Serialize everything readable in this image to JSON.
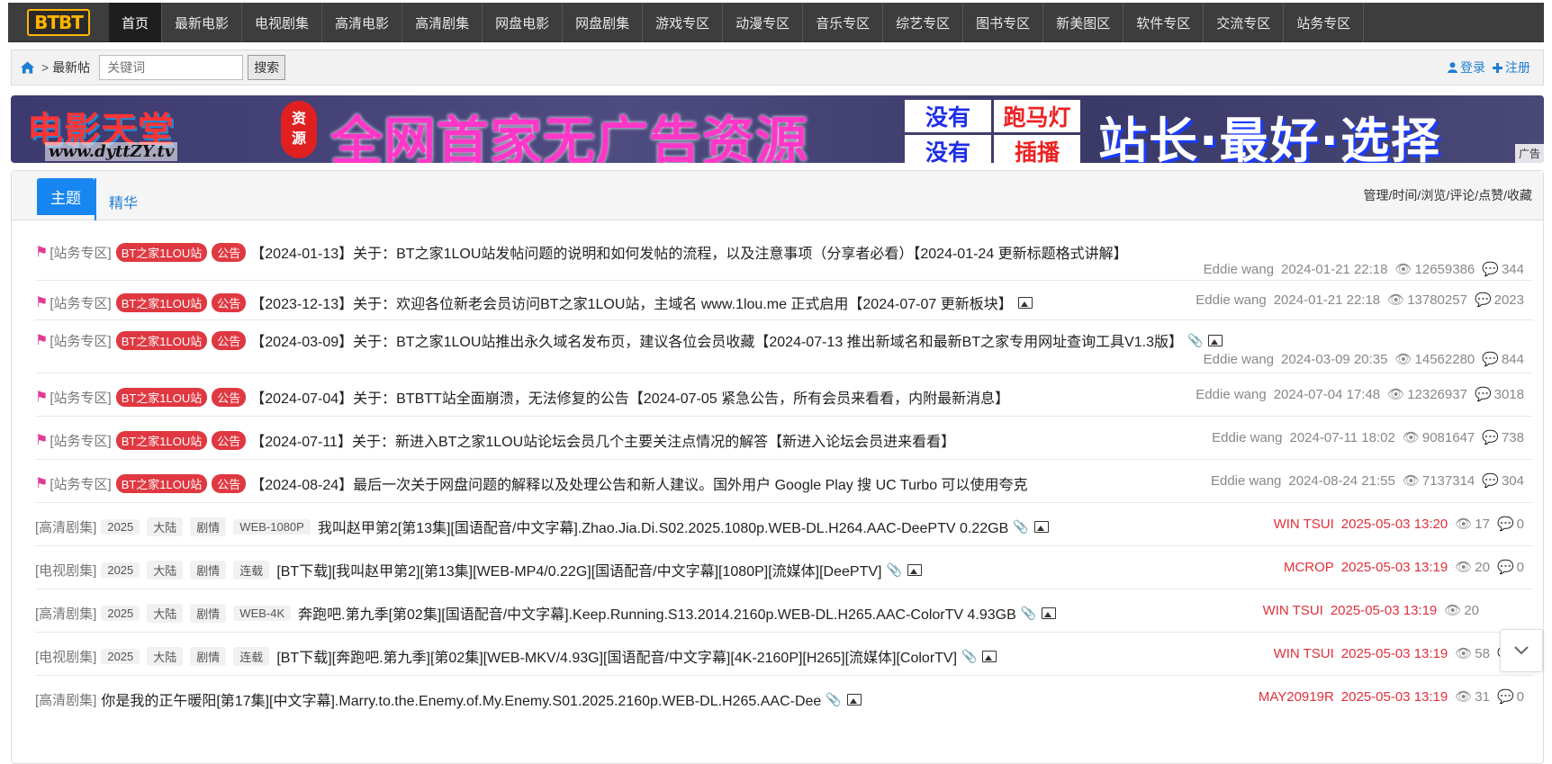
{
  "site": {
    "logo_text": "BTBT"
  },
  "nav": [
    {
      "label": "首页",
      "active": true
    },
    {
      "label": "最新电影"
    },
    {
      "label": "电视剧集"
    },
    {
      "label": "高清电影"
    },
    {
      "label": "高清剧集"
    },
    {
      "label": "网盘电影"
    },
    {
      "label": "网盘剧集"
    },
    {
      "label": "游戏专区"
    },
    {
      "label": "动漫专区"
    },
    {
      "label": "音乐专区"
    },
    {
      "label": "综艺专区"
    },
    {
      "label": "图书专区"
    },
    {
      "label": "新美图区"
    },
    {
      "label": "软件专区"
    },
    {
      "label": "交流专区"
    },
    {
      "label": "站务专区"
    }
  ],
  "breadcrumb": {
    "separator": ">",
    "current": "最新帖"
  },
  "search": {
    "placeholder": "关键词",
    "button": "搜索"
  },
  "auth": {
    "login": "登录",
    "register": "注册"
  },
  "banner": {
    "logo": "电影天堂",
    "url": "www.dyttZY.tv",
    "seal_top": "资",
    "seal_bottom": "源",
    "headline": "全网首家无广告资源",
    "grid": [
      "没有",
      "跑马灯",
      "没有",
      "插播"
    ],
    "slogan": "站长·最好·选择",
    "ad_label": "广告"
  },
  "tabs": {
    "active": "主题",
    "other": "精华"
  },
  "sort_links": "管理/时间/浏览/评论/点赞/收藏",
  "threads": [
    {
      "forum": "[站务专区]",
      "tags": [
        "BT之家1LOU站",
        "公告"
      ],
      "title": "【2024-01-13】关于：BT之家1LOU站发帖问题的说明和如何发帖的流程，以及注意事项（分享者必看）【2024-01-24 更新标题格式讲解】",
      "author": "Eddie wang",
      "time": "2024-01-21 22:18",
      "views": "12659386",
      "replies": "344"
    },
    {
      "forum": "[站务专区]",
      "tags": [
        "BT之家1LOU站",
        "公告"
      ],
      "title": "【2023-12-13】关于：欢迎各位新老会员访问BT之家1LOU站，主域名 www.1lou.me 正式启用【2024-07-07 更新板块】",
      "author": "Eddie wang",
      "time": "2024-01-21 22:18",
      "views": "13780257",
      "replies": "2023"
    },
    {
      "forum": "[站务专区]",
      "tags": [
        "BT之家1LOU站",
        "公告"
      ],
      "title": "【2024-03-09】关于：BT之家1LOU站推出永久域名发布页，建议各位会员收藏【2024-07-13 推出新域名和最新BT之家专用网址查询工具V1.3版】",
      "author": "Eddie wang",
      "time": "2024-03-09 20:35",
      "views": "14562280",
      "replies": "844"
    },
    {
      "forum": "[站务专区]",
      "tags": [
        "BT之家1LOU站",
        "公告"
      ],
      "title": "【2024-07-04】关于：BTBTT站全面崩溃，无法修复的公告【2024-07-05 紧急公告，所有会员来看看，内附最新消息】",
      "author": "Eddie wang",
      "time": "2024-07-04 17:48",
      "views": "12326937",
      "replies": "3018"
    },
    {
      "forum": "[站务专区]",
      "tags": [
        "BT之家1LOU站",
        "公告"
      ],
      "title": "【2024-07-11】关于：新进入BT之家1LOU站论坛会员几个主要关注点情况的解答【新进入论坛会员进来看看】",
      "author": "Eddie wang",
      "time": "2024-07-11 18:02",
      "views": "9081647",
      "replies": "738"
    },
    {
      "forum": "[站务专区]",
      "tags": [
        "BT之家1LOU站",
        "公告"
      ],
      "title": "【2024-08-24】最后一次关于网盘问题的解释以及处理公告和新人建议。国外用户 Google Play 搜 UC Turbo 可以使用夸克",
      "author": "Eddie wang",
      "time": "2024-08-24 21:55",
      "views": "7137314",
      "replies": "304"
    },
    {
      "forum": "[高清剧集]",
      "tags": [
        "2025",
        "大陆",
        "剧情",
        "WEB-1080P"
      ],
      "title": "我叫赵甲第2[第13集][国语配音/中文字幕].Zhao.Jia.Di.S02.2025.1080p.WEB-DL.H264.AAC-DeePTV 0.22GB",
      "author": "WIN TSUI",
      "time": "2025-05-03 13:20",
      "views": "17",
      "replies": "0"
    },
    {
      "forum": "[电视剧集]",
      "tags": [
        "2025",
        "大陆",
        "剧情",
        "连载"
      ],
      "title": "[BT下载][我叫赵甲第2][第13集][WEB-MP4/0.22G][国语配音/中文字幕][1080P][流媒体][DeePTV]",
      "author": "MCROP",
      "time": "2025-05-03 13:19",
      "views": "20",
      "replies": "0"
    },
    {
      "forum": "[高清剧集]",
      "tags": [
        "2025",
        "大陆",
        "剧情",
        "WEB-4K"
      ],
      "title": "奔跑吧.第九季[第02集][国语配音/中文字幕].Keep.Running.S13.2014.2160p.WEB-DL.H265.AAC-ColorTV 4.93GB",
      "author": "WIN TSUI",
      "time": "2025-05-03 13:19",
      "views": "20",
      "replies": ""
    },
    {
      "forum": "[电视剧集]",
      "tags": [
        "2025",
        "大陆",
        "剧情",
        "连载"
      ],
      "title": "[BT下载][奔跑吧.第九季][第02集][WEB-MKV/4.93G][国语配音/中文字幕][4K-2160P][H265][流媒体][ColorTV]",
      "author": "WIN TSUI",
      "time": "2025-05-03 13:19",
      "views": "58",
      "replies": "0"
    },
    {
      "forum": "[高清剧集]",
      "tags": [],
      "title": "你是我的正午暖阳[第17集][中文字幕].Marry.to.the.Enemy.of.My.Enemy.S01.2025.2160p.WEB-DL.H265.AAC-Dee",
      "author": "MAY20919R",
      "time": "2025-05-03 13:19",
      "views": "31",
      "replies": "0"
    }
  ],
  "colors": {
    "accent": "#1786f0",
    "tag_red": "#e03841",
    "nav_bg": "#3d3d3d",
    "author_red": "#e0303a"
  }
}
